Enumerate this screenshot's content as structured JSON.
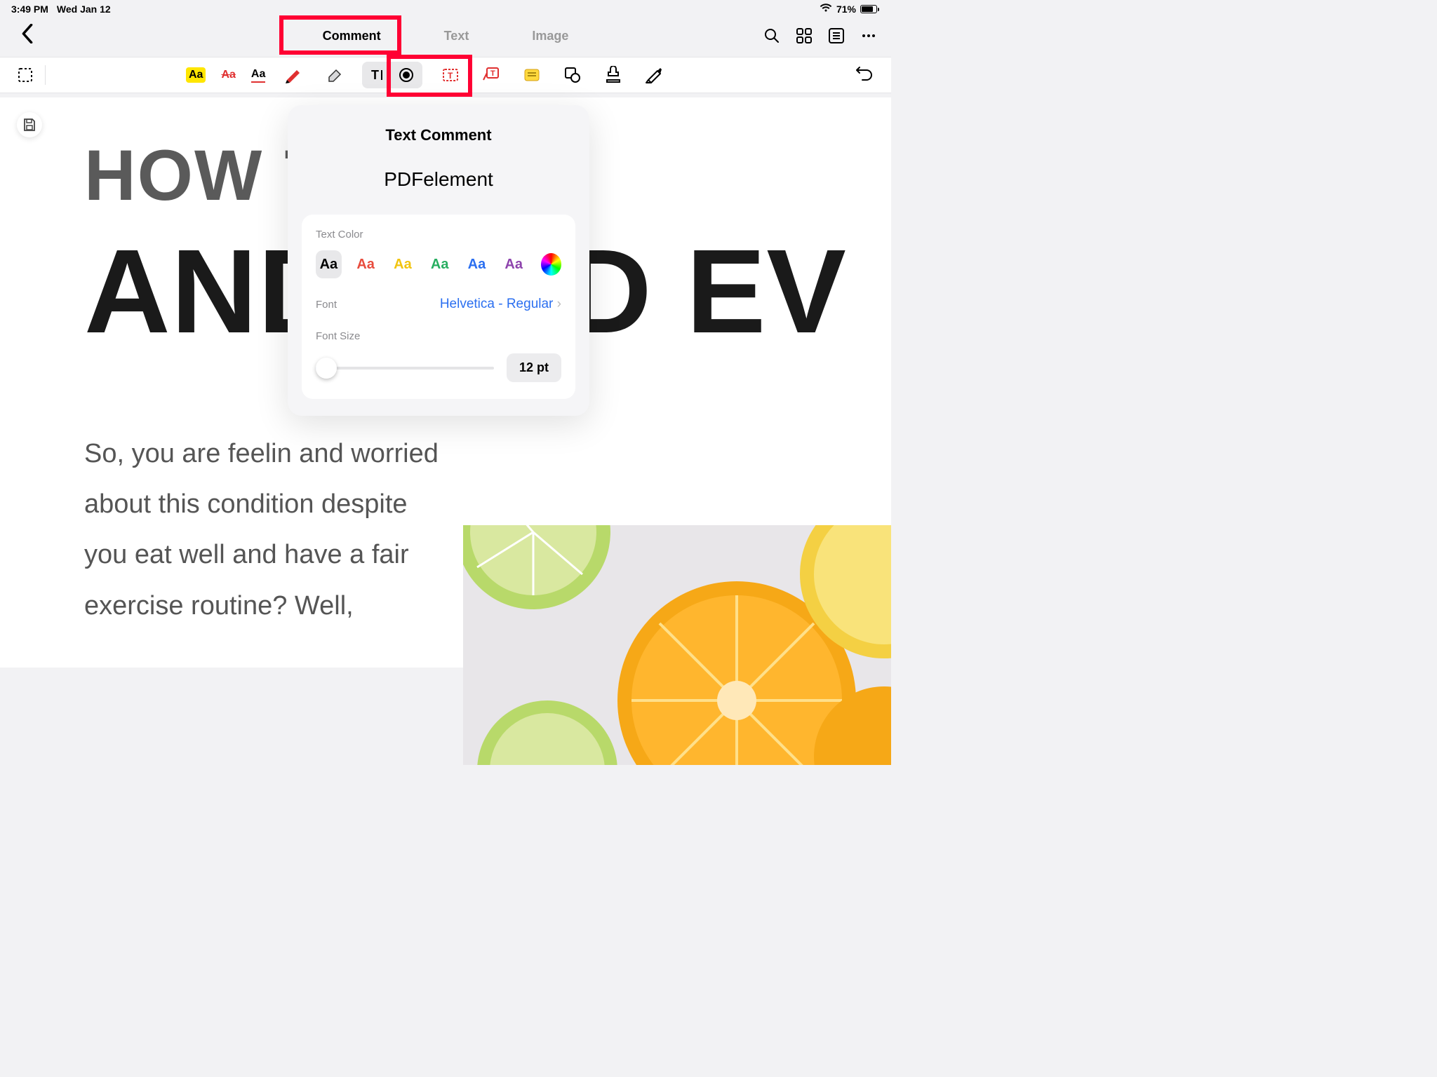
{
  "status": {
    "time": "3:49 PM",
    "date": "Wed Jan 12",
    "battery_pct": "71%"
  },
  "tabs": {
    "comment": "Comment",
    "text": "Text",
    "image": "Image"
  },
  "document": {
    "headline1": "HOW TO                 Y",
    "headline2": "AND           OOD EV",
    "body": "So, you are feelin and worried about this condition despite you eat well and have a fair exercise routine? Well,"
  },
  "popup": {
    "title": "Text Comment",
    "preview": "PDFelement",
    "text_color_label": "Text Color",
    "swatch_text": "Aa",
    "colors": [
      "#000000",
      "#e84c3d",
      "#f1c40f",
      "#27ae60",
      "#2b6ff0",
      "#8e44ad"
    ],
    "font_label": "Font",
    "font_value": "Helvetica - Regular",
    "font_size_label": "Font Size",
    "font_size_value": "12 pt"
  }
}
